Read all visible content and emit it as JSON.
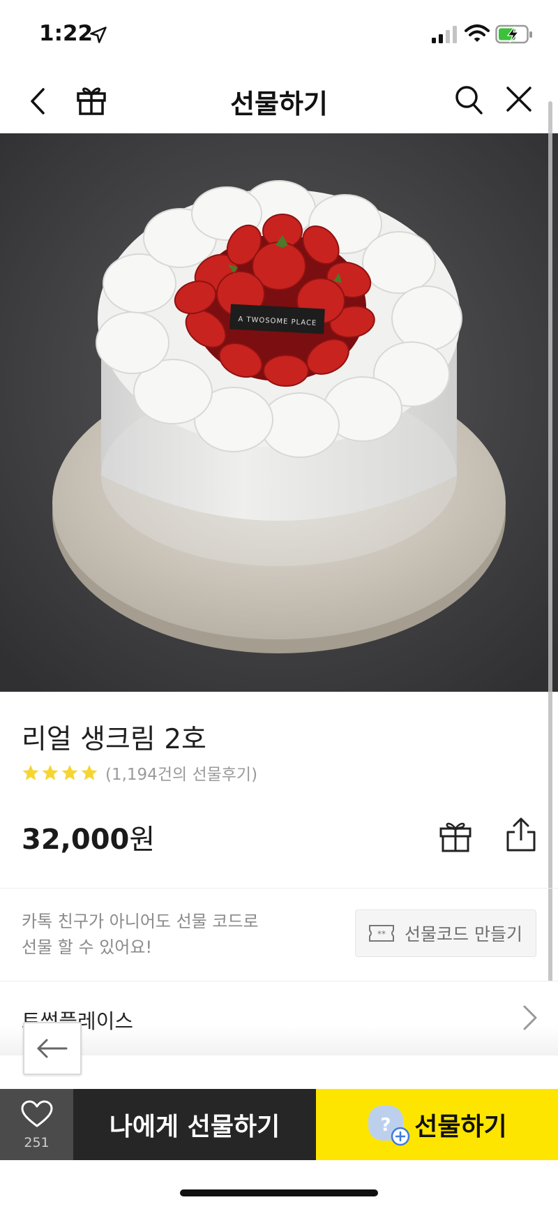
{
  "status_bar": {
    "time": "1:22",
    "icons": [
      "location-arrow-icon",
      "signal-icon",
      "wifi-icon",
      "battery-charging-icon"
    ]
  },
  "nav": {
    "title": "선물하기",
    "icons": [
      "back-chevron-icon",
      "gift-icon",
      "search-icon",
      "close-icon"
    ]
  },
  "product": {
    "image_alt_icon": "strawberry-cake-photo",
    "name": "리얼 생크림 2호",
    "rating_stars": 4,
    "review_count_text": "(1,194건의 선물후기)",
    "price_value": "32,000",
    "price_unit": "원"
  },
  "gift_code": {
    "description_line1": "카톡 친구가 아니어도 선물 코드로",
    "description_line2": "선물 할 수 있어요!",
    "button_label": "선물코드 만들기"
  },
  "brand": {
    "name": "트썸플레이스"
  },
  "action_bar": {
    "like_count": "251",
    "self_gift_label": "나에게 선물하기",
    "gift_label": "선물하기"
  },
  "colors": {
    "accent_yellow": "#fee500",
    "dark_button": "#262626",
    "like_button_bg": "#4b4b4b",
    "star_yellow": "#f6d531"
  }
}
